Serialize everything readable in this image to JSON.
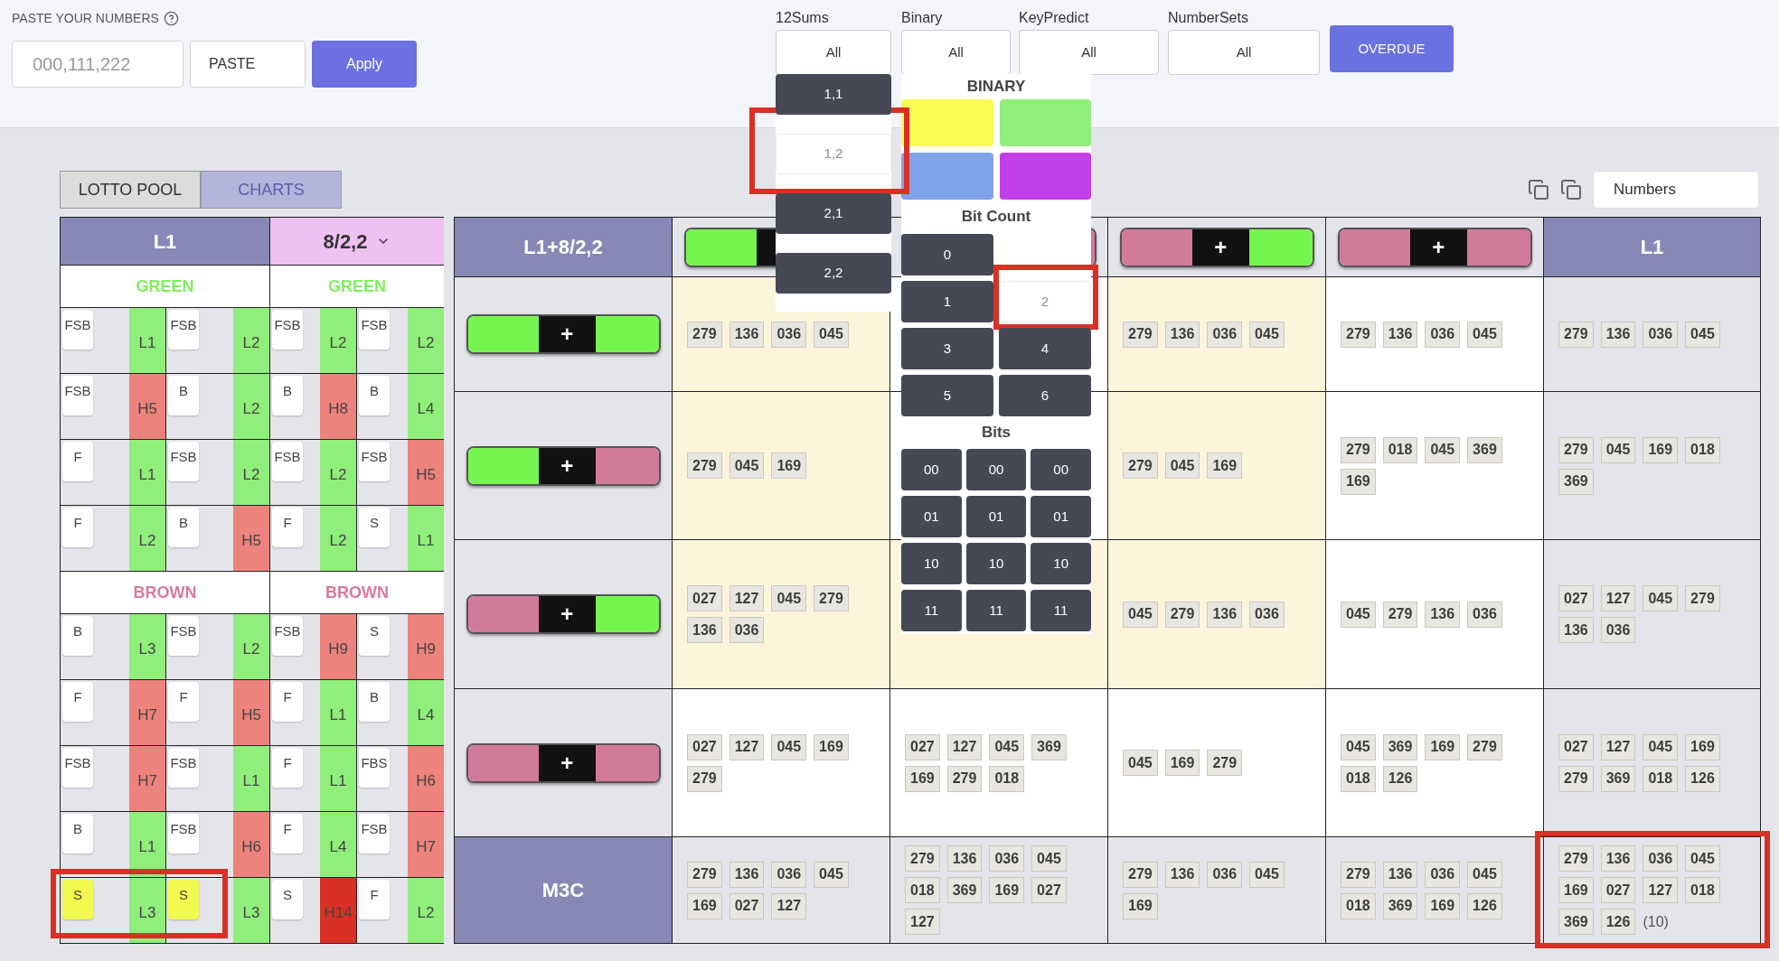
{
  "paste_panel": {
    "label": "PASTE YOUR NUMBERS",
    "input": {
      "placeholder": "000,111,222"
    },
    "paste_button": "PASTE",
    "apply_button": "Apply"
  },
  "filters": [
    {
      "label": "12Sums",
      "value": "All"
    },
    {
      "label": "Binary",
      "value": "All"
    },
    {
      "label": "KeyPredict",
      "value": "All"
    },
    {
      "label": "NumberSets",
      "value": "All"
    }
  ],
  "overdue_button": "OVERDUE",
  "sums_menu": [
    {
      "label": "1,1",
      "selected": false
    },
    {
      "label": "1,2",
      "selected": true
    },
    {
      "label": "2,1",
      "selected": false
    },
    {
      "label": "2,2",
      "selected": false
    }
  ],
  "binary_menu": {
    "title": "BINARY",
    "swatches": [
      {
        "color": "#fafc50"
      },
      {
        "color": "#90ee7a"
      },
      {
        "color": "#7fa3ea"
      },
      {
        "color": "#c23ee8"
      }
    ],
    "bit_count_title": "Bit Count",
    "bit_counts": [
      {
        "label": "0",
        "selected": false
      },
      {
        "label": "1",
        "selected": false
      },
      {
        "label": "2",
        "selected": true
      },
      {
        "label": "3",
        "selected": false
      },
      {
        "label": "4",
        "selected": false
      },
      {
        "label": "5",
        "selected": false
      },
      {
        "label": "6",
        "selected": false
      }
    ],
    "bits_title": "Bits",
    "bits": [
      [
        "00",
        "00",
        "00"
      ],
      [
        "01",
        "01",
        "01"
      ],
      [
        "10",
        "10",
        "10"
      ],
      [
        "11",
        "11",
        "11"
      ]
    ]
  },
  "tabs": [
    {
      "label": "LOTTO POOL",
      "selected": false
    },
    {
      "label": "CHARTS",
      "selected": true
    }
  ],
  "view_select": {
    "value": "Numbers"
  },
  "left_table": {
    "headers": [
      {
        "kind": "title",
        "text": "L1"
      },
      {
        "kind": "select",
        "text": "8/2,2"
      }
    ],
    "sections": [
      {
        "color": "#7df05a",
        "labels": [
          "GREEN",
          "GREEN"
        ],
        "rows": [
          [
            {
              "chip": "FSB",
              "highlighted": false,
              "grade": "L1",
              "color": "#90ee7a"
            },
            {
              "chip": "FSB",
              "highlighted": false,
              "grade": "L2",
              "color": "#90ee7a"
            },
            {
              "chip": "FSB",
              "highlighted": false,
              "grade": "L2",
              "color": "#90ee7a"
            },
            {
              "chip": "FSB",
              "highlighted": false,
              "grade": "L2",
              "color": "#90ee7a"
            }
          ],
          [
            {
              "chip": "FSB",
              "highlighted": false,
              "grade": "H5",
              "color": "#ee827c"
            },
            {
              "chip": "B",
              "highlighted": false,
              "grade": "L2",
              "color": "#90ee7a"
            },
            {
              "chip": "B",
              "highlighted": false,
              "grade": "H8",
              "color": "#ee827c"
            },
            {
              "chip": "B",
              "highlighted": false,
              "grade": "L4",
              "color": "#90ee7a"
            }
          ],
          [
            {
              "chip": "F",
              "highlighted": false,
              "grade": "L1",
              "color": "#90ee7a"
            },
            {
              "chip": "FSB",
              "highlighted": false,
              "grade": "L2",
              "color": "#90ee7a"
            },
            {
              "chip": "FSB",
              "highlighted": false,
              "grade": "L2",
              "color": "#90ee7a"
            },
            {
              "chip": "FSB",
              "highlighted": false,
              "grade": "H5",
              "color": "#ee827c"
            }
          ],
          [
            {
              "chip": "F",
              "highlighted": false,
              "grade": "L2",
              "color": "#90ee7a"
            },
            {
              "chip": "B",
              "highlighted": false,
              "grade": "H5",
              "color": "#ee827c"
            },
            {
              "chip": "F",
              "highlighted": false,
              "grade": "L2",
              "color": "#90ee7a"
            },
            {
              "chip": "S",
              "highlighted": false,
              "grade": "L1",
              "color": "#90ee7a"
            }
          ]
        ]
      },
      {
        "color": "#d97a9a",
        "labels": [
          "BROWN",
          "BROWN"
        ],
        "rows": [
          [
            {
              "chip": "B",
              "highlighted": false,
              "grade": "L3",
              "color": "#90ee7a"
            },
            {
              "chip": "FSB",
              "highlighted": false,
              "grade": "L2",
              "color": "#90ee7a"
            },
            {
              "chip": "FSB",
              "highlighted": false,
              "grade": "H9",
              "color": "#ee827c"
            },
            {
              "chip": "S",
              "highlighted": false,
              "grade": "H9",
              "color": "#ee827c"
            }
          ],
          [
            {
              "chip": "F",
              "highlighted": false,
              "grade": "H7",
              "color": "#ee827c"
            },
            {
              "chip": "F",
              "highlighted": false,
              "grade": "H5",
              "color": "#ee827c"
            },
            {
              "chip": "F",
              "highlighted": false,
              "grade": "L1",
              "color": "#90ee7a"
            },
            {
              "chip": "B",
              "highlighted": false,
              "grade": "L4",
              "color": "#90ee7a"
            }
          ],
          [
            {
              "chip": "FSB",
              "highlighted": false,
              "grade": "H7",
              "color": "#ee827c"
            },
            {
              "chip": "FSB",
              "highlighted": false,
              "grade": "L1",
              "color": "#90ee7a"
            },
            {
              "chip": "F",
              "highlighted": false,
              "grade": "L1",
              "color": "#90ee7a"
            },
            {
              "chip": "FBS",
              "highlighted": false,
              "grade": "H6",
              "color": "#ee827c"
            }
          ],
          [
            {
              "chip": "B",
              "highlighted": false,
              "grade": "L1",
              "color": "#90ee7a"
            },
            {
              "chip": "FSB",
              "highlighted": false,
              "grade": "H6",
              "color": "#ee827c"
            },
            {
              "chip": "F",
              "highlighted": false,
              "grade": "L4",
              "color": "#90ee7a"
            },
            {
              "chip": "FSB",
              "highlighted": false,
              "grade": "H7",
              "color": "#ee827c"
            }
          ],
          [
            {
              "chip": "S",
              "highlighted": true,
              "grade": "L3",
              "color": "#90ee7a"
            },
            {
              "chip": "S",
              "highlighted": true,
              "grade": "L3",
              "color": "#90ee7a"
            },
            {
              "chip": "S",
              "highlighted": false,
              "grade": "H14",
              "color": "#d93025"
            },
            {
              "chip": "F",
              "highlighted": false,
              "grade": "L2",
              "color": "#90ee7a"
            }
          ]
        ]
      }
    ]
  },
  "main_table": {
    "columns": [
      {
        "kind": "title",
        "text": "L1+8/2,2"
      },
      {
        "kind": "pill",
        "left": {
          "color": "#76f54e"
        }
      },
      {
        "kind": "pill",
        "right": {
          "color": "#d27a9a"
        }
      },
      {
        "kind": "pill",
        "symbol": "+",
        "left": {
          "color": "#d27a9a"
        },
        "right": {
          "color": "#76f54e"
        }
      },
      {
        "kind": "pill",
        "symbol": "+",
        "left": {
          "color": "#d27a9a"
        },
        "right": {
          "color": "#d27a9a"
        }
      },
      {
        "kind": "title",
        "text": "L1"
      }
    ],
    "rows": [
      {
        "cells": [
          {
            "kind": "pill",
            "symbol": "+",
            "left": {
              "color": "#76f54e"
            },
            "right": {
              "color": "#76f54e"
            }
          },
          {
            "kind": "numbers",
            "color": "#fcf5db",
            "numbers": [
              "279",
              "136",
              "036",
              "045"
            ]
          },
          {
            "kind": "numbers"
          },
          {
            "kind": "numbers",
            "color": "#fcf5db",
            "numbers": [
              "279",
              "136",
              "036",
              "045"
            ]
          },
          {
            "kind": "numbers",
            "color": "#ffffff",
            "numbers": [
              "279",
              "136",
              "036",
              "045"
            ]
          },
          {
            "kind": "numbers",
            "color": "#e4e5ea",
            "numbers": [
              "279",
              "136",
              "036",
              "045"
            ]
          }
        ]
      },
      {
        "cells": [
          {
            "kind": "pill",
            "symbol": "+",
            "left": {
              "color": "#76f54e"
            },
            "right": {
              "color": "#d27a9a"
            }
          },
          {
            "kind": "numbers",
            "color": "#fcf5db",
            "numbers": [
              "279",
              "045",
              "169"
            ]
          },
          {
            "kind": "numbers"
          },
          {
            "kind": "numbers",
            "color": "#fcf5db",
            "numbers": [
              "279",
              "045",
              "169"
            ]
          },
          {
            "kind": "numbers",
            "color": "#ffffff",
            "numbers": [
              "279",
              "018",
              "045",
              "369",
              "169"
            ]
          },
          {
            "kind": "numbers",
            "color": "#e4e5ea",
            "numbers": [
              "279",
              "045",
              "169",
              "018",
              "369"
            ]
          }
        ]
      },
      {
        "cells": [
          {
            "kind": "pill",
            "symbol": "+",
            "left": {
              "color": "#d27a9a"
            },
            "right": {
              "color": "#76f54e"
            }
          },
          {
            "kind": "numbers",
            "color": "#fcf5db",
            "numbers": [
              "027",
              "127",
              "045",
              "279",
              "136",
              "036"
            ]
          },
          {
            "kind": "numbers",
            "color": "#fcf5db"
          },
          {
            "kind": "numbers",
            "color": "#fcf5db",
            "numbers": [
              "045",
              "279",
              "136",
              "036"
            ]
          },
          {
            "kind": "numbers",
            "color": "#ffffff",
            "numbers": [
              "045",
              "279",
              "136",
              "036"
            ]
          },
          {
            "kind": "numbers",
            "color": "#e4e5ea",
            "numbers": [
              "027",
              "127",
              "045",
              "279",
              "136",
              "036"
            ]
          }
        ]
      },
      {
        "cells": [
          {
            "kind": "pill",
            "symbol": "+",
            "left": {
              "color": "#d27a9a"
            },
            "right": {
              "color": "#d27a9a"
            }
          },
          {
            "kind": "numbers",
            "color": "#ffffff",
            "numbers": [
              "027",
              "127",
              "045",
              "169",
              "279"
            ]
          },
          {
            "kind": "numbers",
            "color": "#ffffff",
            "numbers": [
              "027",
              "127",
              "045",
              "369",
              "169",
              "279",
              "018"
            ]
          },
          {
            "kind": "numbers",
            "color": "#ffffff",
            "numbers": [
              "045",
              "169",
              "279"
            ]
          },
          {
            "kind": "numbers",
            "color": "#ffffff",
            "numbers": [
              "045",
              "369",
              "169",
              "279",
              "018",
              "126"
            ]
          },
          {
            "kind": "numbers",
            "color": "#e4e5ea",
            "numbers": [
              "027",
              "127",
              "045",
              "169",
              "279",
              "369",
              "018",
              "126"
            ]
          }
        ]
      },
      {
        "cells": [
          {
            "kind": "title",
            "text": "M3C"
          },
          {
            "kind": "numbers",
            "color": "#e4e5ea",
            "numbers": [
              "279",
              "136",
              "036",
              "045",
              "169",
              "027",
              "127"
            ]
          },
          {
            "kind": "numbers",
            "color": "#e4e5ea",
            "numbers": [
              "279",
              "136",
              "036",
              "045",
              "018",
              "369",
              "169",
              "027",
              "127"
            ]
          },
          {
            "kind": "numbers",
            "color": "#e4e5ea",
            "numbers": [
              "279",
              "136",
              "036",
              "045",
              "169"
            ]
          },
          {
            "kind": "numbers",
            "color": "#e4e5ea",
            "numbers": [
              "279",
              "136",
              "036",
              "045",
              "018",
              "369",
              "169",
              "126"
            ]
          },
          {
            "kind": "numbers",
            "color": "#e4e5ea",
            "numbers": [
              "279",
              "136",
              "036",
              "045",
              "169",
              "027",
              "127",
              "018",
              "369",
              "126"
            ],
            "count": "(10)"
          }
        ]
      }
    ]
  }
}
